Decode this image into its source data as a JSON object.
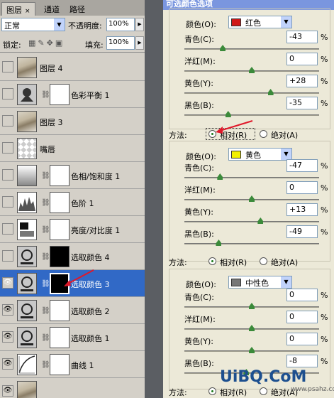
{
  "layers_panel": {
    "tabs": [
      {
        "label": "图层",
        "close": "×"
      },
      {
        "label": "通道"
      },
      {
        "label": "路径"
      }
    ],
    "blend_mode": "正常",
    "opacity_label": "不透明度:",
    "opacity_value": "100%",
    "lock_label": "锁定:",
    "fill_label": "填充:",
    "fill_value": "100%",
    "layers": [
      {
        "name": "图层 4",
        "visible": false,
        "selected": false
      },
      {
        "name": "色彩平衡 1",
        "visible": false,
        "selected": false
      },
      {
        "name": "图层 3",
        "visible": false,
        "selected": false
      },
      {
        "name": "嘴唇",
        "visible": false,
        "selected": false
      },
      {
        "name": "色相/饱和度 1",
        "visible": false,
        "selected": false
      },
      {
        "name": "色阶 1",
        "visible": false,
        "selected": false
      },
      {
        "name": "亮度/对比度 1",
        "visible": false,
        "selected": false
      },
      {
        "name": "选取颜色 4",
        "visible": false,
        "selected": false
      },
      {
        "name": "选取颜色 3",
        "visible": true,
        "selected": true
      },
      {
        "name": "选取颜色 2",
        "visible": true,
        "selected": false
      },
      {
        "name": "选取颜色 1",
        "visible": true,
        "selected": false
      },
      {
        "name": "曲线 1",
        "visible": true,
        "selected": false
      }
    ]
  },
  "dialog": {
    "title": "可选颜色选项",
    "color_label": "颜色(O):",
    "method_label": "方法:",
    "relative_label": "相对(R)",
    "absolute_label": "绝对(A)",
    "sections": [
      {
        "color_name": "红色",
        "swatch": "#d01818",
        "params": [
          {
            "label": "青色(C):",
            "value": "-43",
            "pct": "%",
            "level": -43
          },
          {
            "label": "洋红(M):",
            "value": "0",
            "pct": "%",
            "level": 0
          },
          {
            "label": "黄色(Y):",
            "value": "+28",
            "pct": "%",
            "level": 28
          },
          {
            "label": "黑色(B):",
            "value": "-35",
            "pct": "%",
            "level": -35
          }
        ],
        "method": "relative"
      },
      {
        "color_name": "黄色",
        "swatch": "#f2f000",
        "params": [
          {
            "label": "青色(C):",
            "value": "-47",
            "pct": "%",
            "level": -47
          },
          {
            "label": "洋红(M):",
            "value": "0",
            "pct": "%",
            "level": 0
          },
          {
            "label": "黄色(Y):",
            "value": "+13",
            "pct": "%",
            "level": 13
          },
          {
            "label": "黑色(B):",
            "value": "-49",
            "pct": "%",
            "level": -49
          }
        ],
        "method": "relative"
      },
      {
        "color_name": "中性色",
        "swatch": "#777777",
        "params": [
          {
            "label": "青色(C):",
            "value": "0",
            "pct": "%",
            "level": 0
          },
          {
            "label": "洋红(M):",
            "value": "0",
            "pct": "%",
            "level": 0
          },
          {
            "label": "黄色(Y):",
            "value": "0",
            "pct": "%",
            "level": 0
          },
          {
            "label": "黑色(B):",
            "value": "-8",
            "pct": "%",
            "level": -8
          }
        ],
        "method": "relative"
      }
    ]
  },
  "watermark": {
    "brand": "UiBQ.CoM",
    "site": "www.psahz.com"
  },
  "colors": {
    "selection": "#3169c6",
    "annotation_arrow": "#e0182a",
    "title_bar": "#7a96df"
  }
}
